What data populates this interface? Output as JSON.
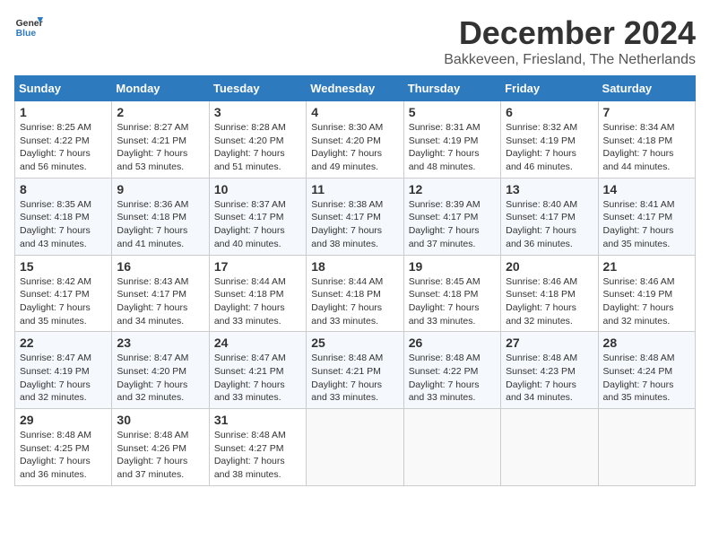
{
  "logo": {
    "text_general": "General",
    "text_blue": "Blue"
  },
  "title": "December 2024",
  "location": "Bakkeveen, Friesland, The Netherlands",
  "days_of_week": [
    "Sunday",
    "Monday",
    "Tuesday",
    "Wednesday",
    "Thursday",
    "Friday",
    "Saturday"
  ],
  "weeks": [
    [
      {
        "day": "1",
        "sunrise": "8:25 AM",
        "sunset": "4:22 PM",
        "daylight": "7 hours and 56 minutes."
      },
      {
        "day": "2",
        "sunrise": "8:27 AM",
        "sunset": "4:21 PM",
        "daylight": "7 hours and 53 minutes."
      },
      {
        "day": "3",
        "sunrise": "8:28 AM",
        "sunset": "4:20 PM",
        "daylight": "7 hours and 51 minutes."
      },
      {
        "day": "4",
        "sunrise": "8:30 AM",
        "sunset": "4:20 PM",
        "daylight": "7 hours and 49 minutes."
      },
      {
        "day": "5",
        "sunrise": "8:31 AM",
        "sunset": "4:19 PM",
        "daylight": "7 hours and 48 minutes."
      },
      {
        "day": "6",
        "sunrise": "8:32 AM",
        "sunset": "4:19 PM",
        "daylight": "7 hours and 46 minutes."
      },
      {
        "day": "7",
        "sunrise": "8:34 AM",
        "sunset": "4:18 PM",
        "daylight": "7 hours and 44 minutes."
      }
    ],
    [
      {
        "day": "8",
        "sunrise": "8:35 AM",
        "sunset": "4:18 PM",
        "daylight": "7 hours and 43 minutes."
      },
      {
        "day": "9",
        "sunrise": "8:36 AM",
        "sunset": "4:18 PM",
        "daylight": "7 hours and 41 minutes."
      },
      {
        "day": "10",
        "sunrise": "8:37 AM",
        "sunset": "4:17 PM",
        "daylight": "7 hours and 40 minutes."
      },
      {
        "day": "11",
        "sunrise": "8:38 AM",
        "sunset": "4:17 PM",
        "daylight": "7 hours and 38 minutes."
      },
      {
        "day": "12",
        "sunrise": "8:39 AM",
        "sunset": "4:17 PM",
        "daylight": "7 hours and 37 minutes."
      },
      {
        "day": "13",
        "sunrise": "8:40 AM",
        "sunset": "4:17 PM",
        "daylight": "7 hours and 36 minutes."
      },
      {
        "day": "14",
        "sunrise": "8:41 AM",
        "sunset": "4:17 PM",
        "daylight": "7 hours and 35 minutes."
      }
    ],
    [
      {
        "day": "15",
        "sunrise": "8:42 AM",
        "sunset": "4:17 PM",
        "daylight": "7 hours and 35 minutes."
      },
      {
        "day": "16",
        "sunrise": "8:43 AM",
        "sunset": "4:17 PM",
        "daylight": "7 hours and 34 minutes."
      },
      {
        "day": "17",
        "sunrise": "8:44 AM",
        "sunset": "4:18 PM",
        "daylight": "7 hours and 33 minutes."
      },
      {
        "day": "18",
        "sunrise": "8:44 AM",
        "sunset": "4:18 PM",
        "daylight": "7 hours and 33 minutes."
      },
      {
        "day": "19",
        "sunrise": "8:45 AM",
        "sunset": "4:18 PM",
        "daylight": "7 hours and 33 minutes."
      },
      {
        "day": "20",
        "sunrise": "8:46 AM",
        "sunset": "4:18 PM",
        "daylight": "7 hours and 32 minutes."
      },
      {
        "day": "21",
        "sunrise": "8:46 AM",
        "sunset": "4:19 PM",
        "daylight": "7 hours and 32 minutes."
      }
    ],
    [
      {
        "day": "22",
        "sunrise": "8:47 AM",
        "sunset": "4:19 PM",
        "daylight": "7 hours and 32 minutes."
      },
      {
        "day": "23",
        "sunrise": "8:47 AM",
        "sunset": "4:20 PM",
        "daylight": "7 hours and 32 minutes."
      },
      {
        "day": "24",
        "sunrise": "8:47 AM",
        "sunset": "4:21 PM",
        "daylight": "7 hours and 33 minutes."
      },
      {
        "day": "25",
        "sunrise": "8:48 AM",
        "sunset": "4:21 PM",
        "daylight": "7 hours and 33 minutes."
      },
      {
        "day": "26",
        "sunrise": "8:48 AM",
        "sunset": "4:22 PM",
        "daylight": "7 hours and 33 minutes."
      },
      {
        "day": "27",
        "sunrise": "8:48 AM",
        "sunset": "4:23 PM",
        "daylight": "7 hours and 34 minutes."
      },
      {
        "day": "28",
        "sunrise": "8:48 AM",
        "sunset": "4:24 PM",
        "daylight": "7 hours and 35 minutes."
      }
    ],
    [
      {
        "day": "29",
        "sunrise": "8:48 AM",
        "sunset": "4:25 PM",
        "daylight": "7 hours and 36 minutes."
      },
      {
        "day": "30",
        "sunrise": "8:48 AM",
        "sunset": "4:26 PM",
        "daylight": "7 hours and 37 minutes."
      },
      {
        "day": "31",
        "sunrise": "8:48 AM",
        "sunset": "4:27 PM",
        "daylight": "7 hours and 38 minutes."
      },
      null,
      null,
      null,
      null
    ]
  ]
}
